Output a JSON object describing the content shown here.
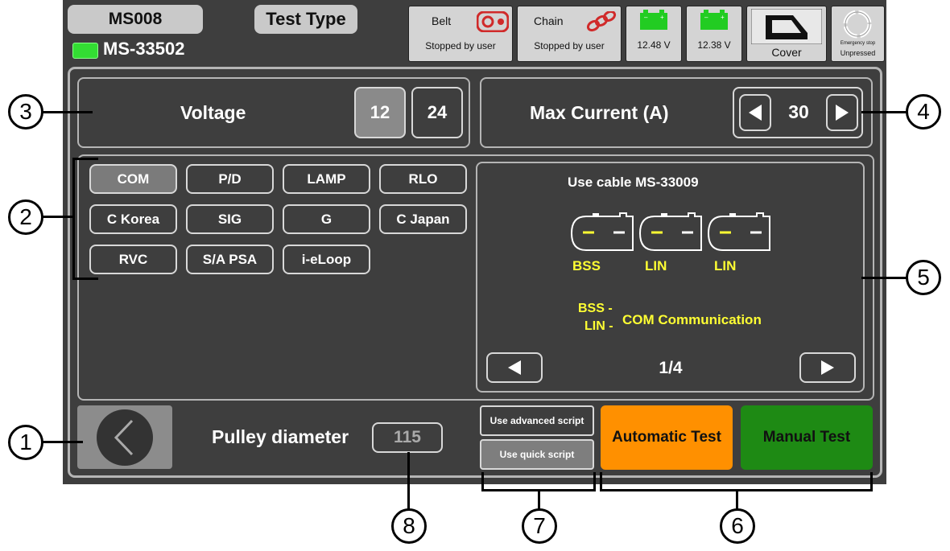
{
  "header": {
    "device_id": "MS008",
    "test_type": "Test Type",
    "model": "MS-33502",
    "belt": {
      "title": "Belt",
      "status": "Stopped by user",
      "icon": "belt-motor-icon"
    },
    "chain": {
      "title": "Chain",
      "status": "Stopped by user",
      "icon": "chain-icon"
    },
    "battery1": {
      "value": "12.48 V",
      "icon": "battery-icon"
    },
    "battery2": {
      "value": "12.38 V",
      "icon": "battery-icon"
    },
    "cover": {
      "label": "Cover",
      "icon": "cover-icon"
    },
    "emergency": {
      "title": "Emergency stop",
      "status": "Unpressed",
      "icon": "emergency-stop-icon"
    }
  },
  "voltage": {
    "label": "Voltage",
    "options": [
      "12",
      "24"
    ],
    "selected": "12"
  },
  "max_current": {
    "label": "Max Current (A)",
    "value": "30"
  },
  "protocols": {
    "items": [
      "COM",
      "P/D",
      "LAMP",
      "RLO",
      "C Korea",
      "SIG",
      "G",
      "C Japan",
      "RVC",
      "S/A PSA",
      "i-eLoop"
    ],
    "selected": "COM"
  },
  "cable_panel": {
    "title": "Use cable MS-33009",
    "pins": [
      "BSS",
      "LIN",
      "LIN"
    ],
    "legend_keys": [
      "BSS -",
      "LIN -"
    ],
    "legend_text": "COM Communication",
    "page": "1/4"
  },
  "footer": {
    "pulley_label": "Pulley diameter",
    "pulley_value": "115",
    "advanced_script": "Use advanced script",
    "quick_script": "Use quick script",
    "automatic_test": "Automatic Test",
    "manual_test": "Manual Test"
  },
  "callouts": [
    "1",
    "2",
    "3",
    "4",
    "5",
    "6",
    "7",
    "8"
  ],
  "colors": {
    "background": "#3e3e3e",
    "automatic": "#ff9000",
    "manual": "#1e8a14",
    "accent_yellow": "#ffff33",
    "battery_green": "#22cc22",
    "status_red": "#d02a2a"
  }
}
